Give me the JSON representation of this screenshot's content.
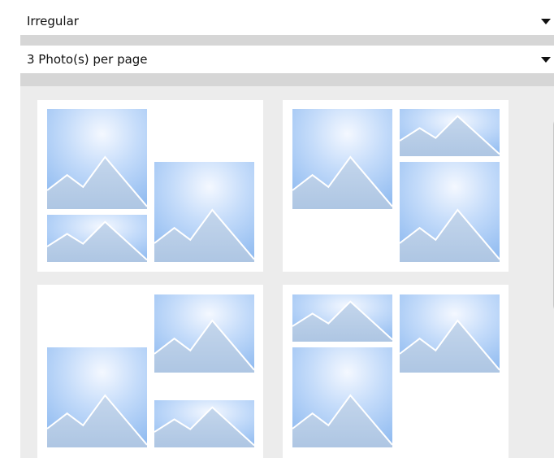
{
  "layout_style": {
    "selected": "Irregular"
  },
  "photos_per_page": {
    "selected": "3 Photo(s) per page"
  },
  "icons": {
    "dropdown_arrow": "triangle-down-icon",
    "scroll_up": "triangle-up-icon",
    "placeholder": "landscape-mountain-icon"
  },
  "colors": {
    "panel_bg": "#ececec",
    "separator": "#d6d6d6",
    "scroll_thumb": "#c7c7c7",
    "sky_light": "#eaf2ff",
    "sky_blue": "#9bc3f3",
    "mountain": "#b7cde6"
  }
}
